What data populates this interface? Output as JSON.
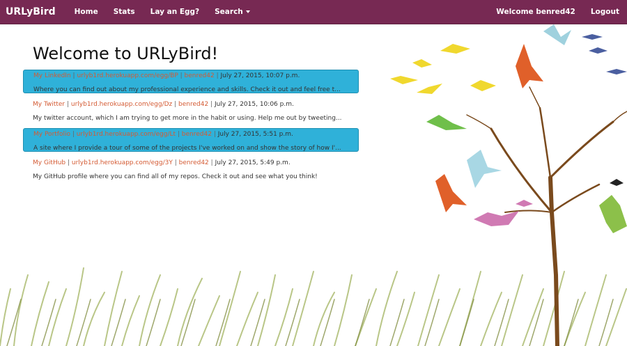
{
  "navbar": {
    "brand": "URLyBird",
    "left_items": [
      "Home",
      "Stats",
      "Lay an Egg?",
      "Search"
    ],
    "welcome_text": "Welcome benred42",
    "logout_label": "Logout"
  },
  "page": {
    "title": "Welcome to URLyBird!"
  },
  "entries": [
    {
      "title": "My LinkedIn",
      "url": "urlyb1rd.herokuapp.com/egg/BP",
      "user": "benred42",
      "date": "July 27, 2015, 10:07 p.m.",
      "desc": "Where you can find out about my professional experience and skills. Check it out and feel free t...",
      "highlight": true
    },
    {
      "title": "My Twitter",
      "url": "urlyb1rd.herokuapp.com/egg/Dz",
      "user": "benred42",
      "date": "July 27, 2015, 10:06 p.m.",
      "desc": "My twitter account, which I am trying to get more in the habit or using. Help me out by tweeting...",
      "highlight": false
    },
    {
      "title": "My Portfolio",
      "url": "urlyb1rd.herokuapp.com/egg/Lt",
      "user": "benred42",
      "date": "July 27, 2015, 5:51 p.m.",
      "desc": "A site where I provide a tour of some of the projects I've worked on and show the story of how I'...",
      "highlight": true
    },
    {
      "title": "My GitHub",
      "url": "urlyb1rd.herokuapp.com/egg/3Y",
      "user": "benred42",
      "date": "July 27, 2015, 5:49 p.m.",
      "desc": "My GitHub profile where you can find all of my repos. Check it out and see what you think!",
      "highlight": false
    }
  ],
  "colors": {
    "navbar": "#772953",
    "highlight": "#2fb1d9",
    "link": "#d45b34"
  },
  "icons": {
    "search_caret": "caret-down-icon"
  }
}
